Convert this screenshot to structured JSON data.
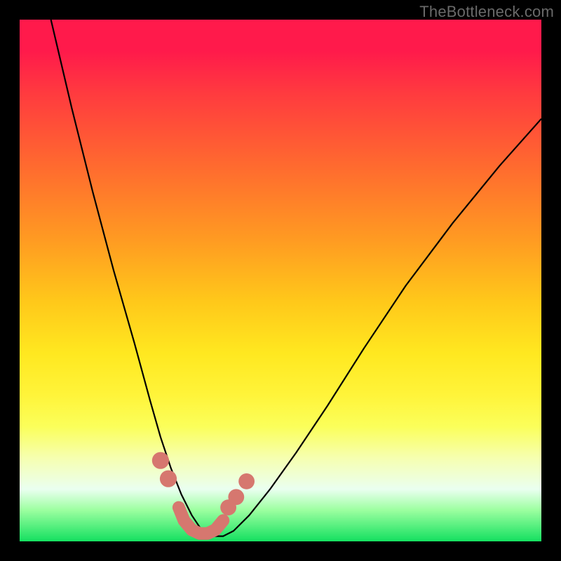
{
  "watermark": "TheBottleneck.com",
  "chart_data": {
    "type": "line",
    "title": "",
    "xlabel": "",
    "ylabel": "",
    "xlim": [
      0,
      100
    ],
    "ylim": [
      0,
      100
    ],
    "grid": false,
    "series": [
      {
        "name": "bottleneck-curve",
        "color": "#000000",
        "x": [
          6,
          10,
          14,
          18,
          22,
          25,
          27,
          29,
          31,
          33,
          35,
          37,
          39,
          41,
          44,
          48,
          53,
          59,
          66,
          74,
          83,
          92,
          100
        ],
        "y": [
          100,
          83,
          67,
          52,
          38,
          27,
          20,
          14,
          9,
          5,
          2,
          1,
          1,
          2,
          5,
          10,
          17,
          26,
          37,
          49,
          61,
          72,
          81
        ]
      }
    ],
    "markers": [
      {
        "name": "marker-left-upper",
        "x": 27.0,
        "y": 15.5,
        "r": 1.8,
        "color": "#d6776f"
      },
      {
        "name": "marker-left-lower",
        "x": 28.5,
        "y": 12.0,
        "r": 1.8,
        "color": "#d6776f"
      },
      {
        "name": "marker-right-1",
        "x": 40.0,
        "y": 6.5,
        "r": 1.7,
        "color": "#d6776f"
      },
      {
        "name": "marker-right-2",
        "x": 41.5,
        "y": 8.5,
        "r": 1.7,
        "color": "#d6776f"
      },
      {
        "name": "marker-right-3",
        "x": 43.5,
        "y": 11.5,
        "r": 1.7,
        "color": "#d6776f"
      }
    ],
    "valley_strip": {
      "name": "valley-strip",
      "color": "#d6776f",
      "points": [
        {
          "x": 30.5,
          "y": 6.5
        },
        {
          "x": 31.5,
          "y": 4.0
        },
        {
          "x": 33.0,
          "y": 2.2
        },
        {
          "x": 34.5,
          "y": 1.5
        },
        {
          "x": 36.0,
          "y": 1.5
        },
        {
          "x": 37.5,
          "y": 2.2
        },
        {
          "x": 39.0,
          "y": 4.0
        }
      ]
    }
  },
  "colors": {
    "frame": "#000000",
    "marker": "#d6776f",
    "curve": "#000000"
  }
}
